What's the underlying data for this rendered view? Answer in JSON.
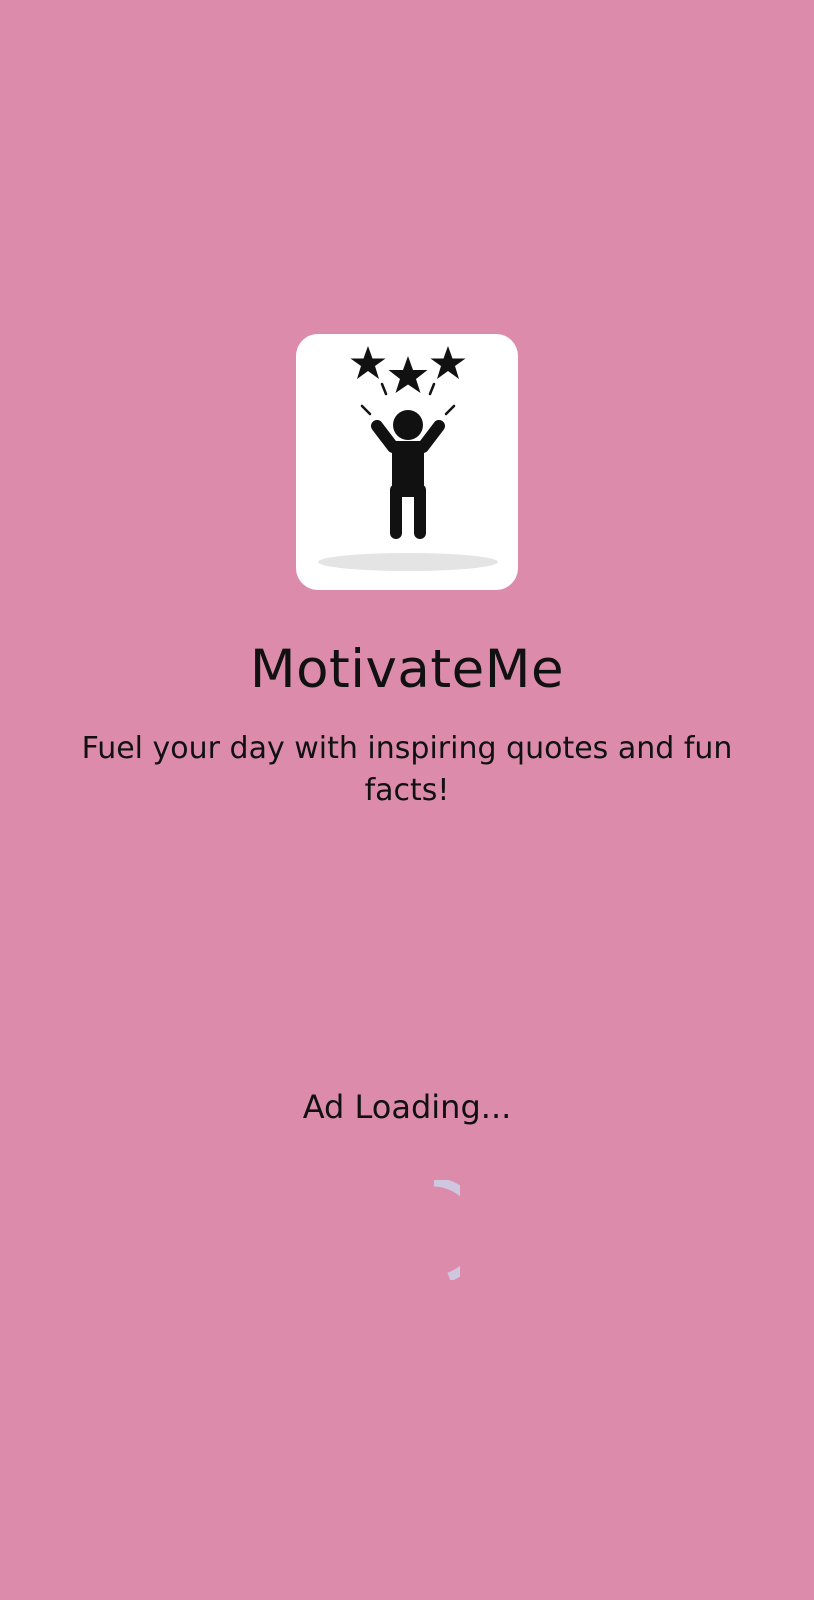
{
  "colors": {
    "background": "#dc8caa",
    "card": "#ffffff",
    "figure": "#111111",
    "shadow": "#e4e4e4",
    "spinner": "#cfc6e0"
  },
  "logo": {
    "icon": "person-celebrating-stars-icon"
  },
  "app": {
    "title": "MotivateMe",
    "tagline": "Fuel your day with inspiring quotes and fun facts!"
  },
  "ad": {
    "status": "Ad Loading..."
  },
  "spinner": {
    "icon": "loading-spinner-icon"
  }
}
